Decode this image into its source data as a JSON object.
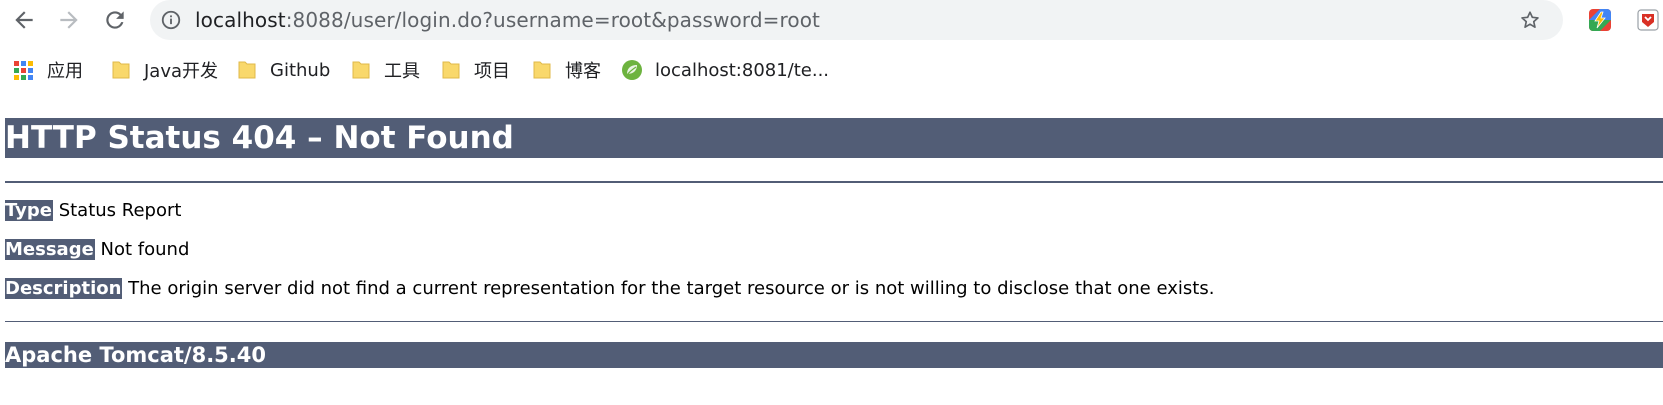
{
  "browser": {
    "url_host": "localhost",
    "url_rest": ":8088/user/login.do?username=root&password=root"
  },
  "bookmarks": [
    {
      "label": "应用",
      "icon": "apps-grid-icon"
    },
    {
      "label": "Java开发",
      "icon": "folder-icon"
    },
    {
      "label": "Github",
      "icon": "folder-icon"
    },
    {
      "label": "工具",
      "icon": "folder-icon"
    },
    {
      "label": "项目",
      "icon": "folder-icon"
    },
    {
      "label": "博客",
      "icon": "folder-icon"
    },
    {
      "label": "localhost:8081/te...",
      "icon": "spring-leaf-icon"
    }
  ],
  "colors": {
    "tomcat_bar": "#525d76",
    "folder": "#f9d86b",
    "leaf": "#6db33f"
  },
  "error_page": {
    "title": "HTTP Status 404 – Not Found",
    "type_label": "Type",
    "type_value": " Status Report",
    "message_label": "Message",
    "message_value": " Not found",
    "description_label": "Description",
    "description_value": " The origin server did not find a current representation for the target resource or is not willing to disclose that one exists.",
    "footer": "Apache Tomcat/8.5.40"
  }
}
